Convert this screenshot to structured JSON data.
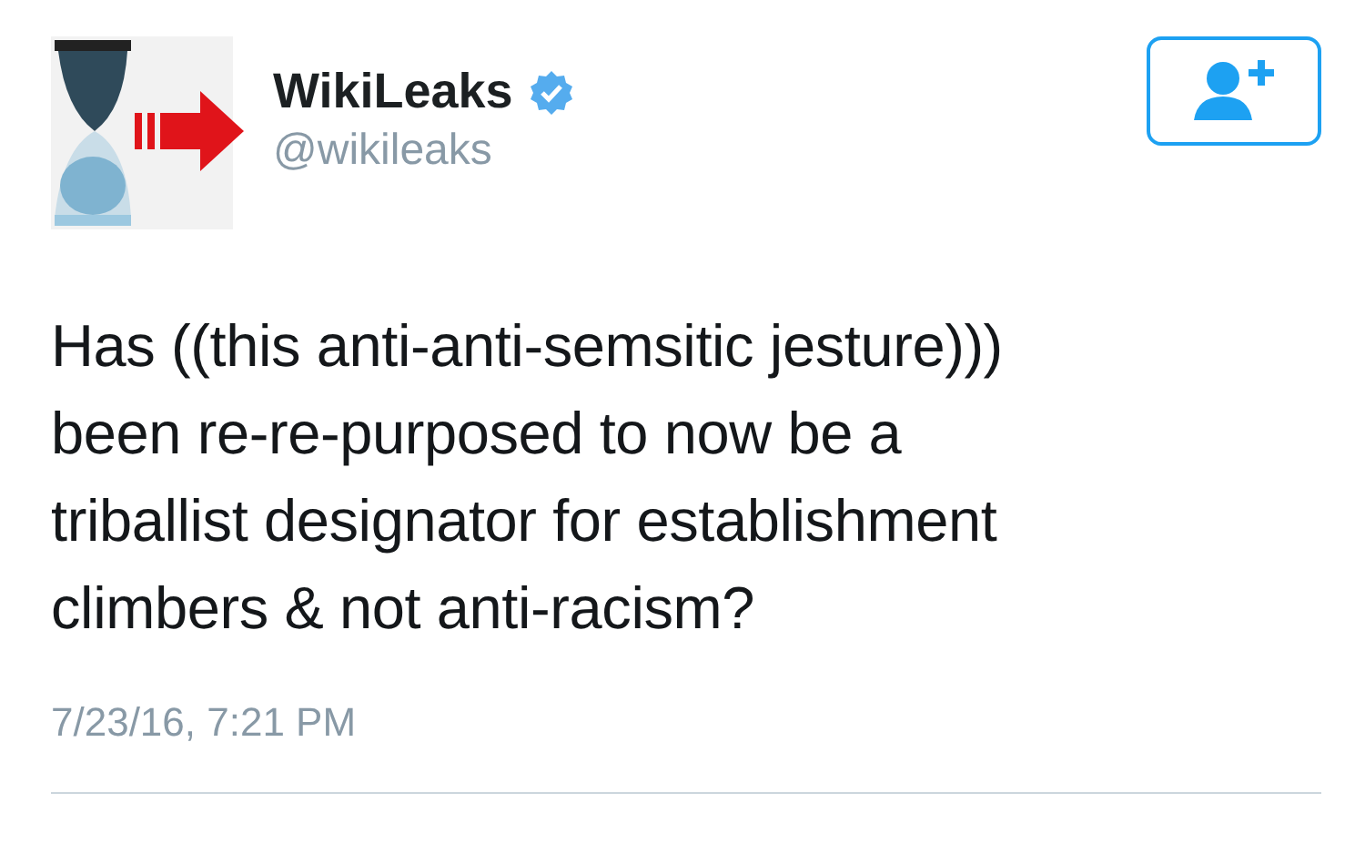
{
  "author": {
    "name": "WikiLeaks",
    "verified": true,
    "handle": "@wikileaks"
  },
  "follow_button": {
    "following": false
  },
  "tweet": {
    "lines": [
      "Has ((this anti-anti-semsitic jesture)))",
      "been re-re-purposed to now be a",
      "triballist designator for establishment",
      "climbers & not anti-racism?"
    ],
    "timestamp": "7/23/16, 7:21 PM"
  }
}
